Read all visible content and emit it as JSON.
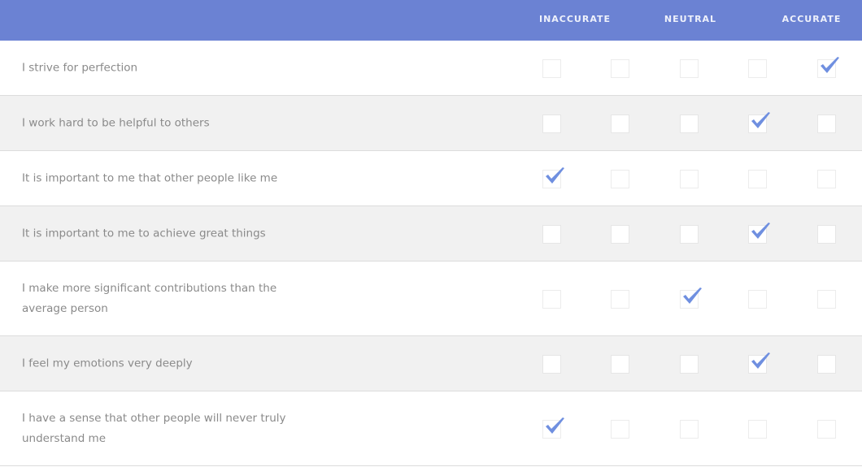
{
  "header": {
    "columns": [
      "INACCURATE",
      "NEUTRAL",
      "ACCURATE"
    ]
  },
  "scale_points": 5,
  "accent_color": "#6b82d3",
  "check_color": "#6f8fe0",
  "rows": [
    {
      "statement": "I strive for perfection",
      "selected": 5
    },
    {
      "statement": "I work hard to be helpful to others",
      "selected": 4
    },
    {
      "statement": "It is important to me that other people like me",
      "selected": 1
    },
    {
      "statement": "It is important to me to achieve great things",
      "selected": 4
    },
    {
      "statement": "I make more significant contributions than the average person",
      "selected": 3
    },
    {
      "statement": "I feel my emotions very deeply",
      "selected": 4
    },
    {
      "statement": "I have a sense that other people will never truly understand me",
      "selected": 1
    }
  ]
}
